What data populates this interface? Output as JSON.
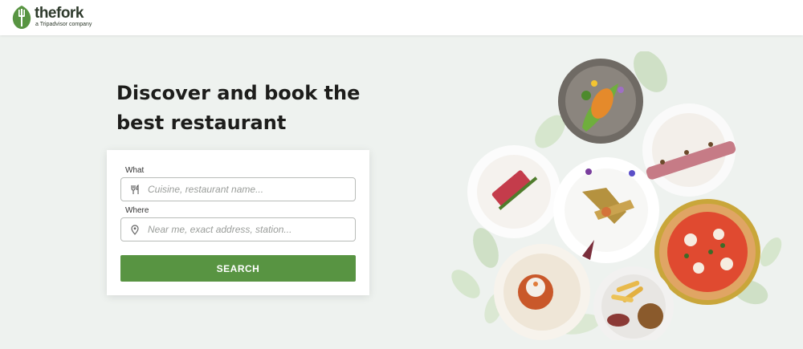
{
  "brand": {
    "name": "thefork",
    "tagline": "a Tripadvisor company",
    "color": "#589442"
  },
  "hero": {
    "headline": "Discover and book the best restaurant"
  },
  "search": {
    "what_label": "What",
    "what_placeholder": "Cuisine, restaurant name...",
    "what_icon": "cutlery-icon",
    "where_label": "Where",
    "where_placeholder": "Near me, exact address, station...",
    "where_icon": "location-pin-icon",
    "button_label": "SEARCH",
    "button_color": "#589442"
  }
}
